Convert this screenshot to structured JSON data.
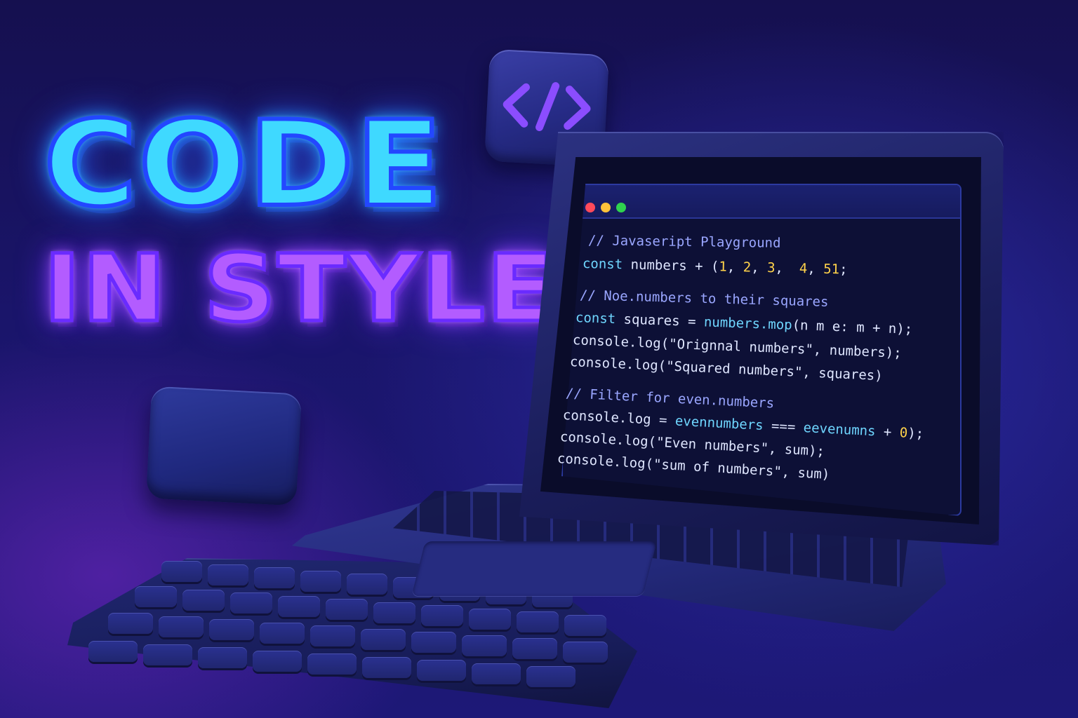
{
  "headline": {
    "line1": "CODE",
    "line2": "IN STYLE"
  },
  "icons": {
    "code_tile": "code-brackets-icon"
  },
  "editor": {
    "window_controls": [
      "close",
      "minimize",
      "maximize"
    ],
    "lines": [
      "// Javaseript Playground",
      "const numbers + (1, 2, 3,  4, 51;",
      "// Noe.numbers to their squares",
      "const squares = numbers.mop(n m e: m + n);",
      "console.log(\"Orignnal numbers\", numbers);",
      "console.log(\"Squared numbers\", squares)",
      "// Filter for even.numbers",
      "console.log = evennumbers === eevenumns + 0);",
      "console.log(\"Even numbers\", sum);",
      "console.log(\"sum of numbers\", sum)"
    ]
  },
  "colors": {
    "headline_cyan": "#3fd9ff",
    "headline_purple": "#b35cff",
    "code_keyword": "#6fd6ff",
    "code_number": "#ffd24a",
    "code_comment": "#9aa6ff",
    "dot_red": "#ff4a5a",
    "dot_yellow": "#ffc23a",
    "dot_green": "#2fd24e"
  }
}
